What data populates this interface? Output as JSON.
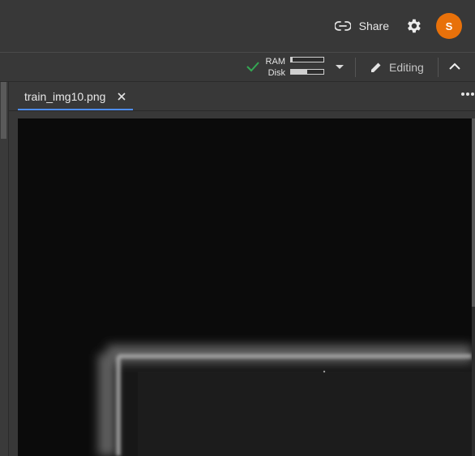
{
  "header": {
    "share_label": "Share",
    "settings_icon": "gear-icon",
    "avatar_initial": "S",
    "avatar_color": "#e8710a"
  },
  "toolbar": {
    "status_icon": "check-icon",
    "status_color": "#34a853",
    "ram_label": "RAM",
    "disk_label": "Disk",
    "ram_usage": 0.05,
    "disk_usage": 0.5,
    "editing_label": "Editing",
    "collapse_icon": "chevron-up-icon"
  },
  "tabs": [
    {
      "label": "train_img10.png",
      "active": true
    }
  ],
  "accent_color": "#4f8ef7"
}
